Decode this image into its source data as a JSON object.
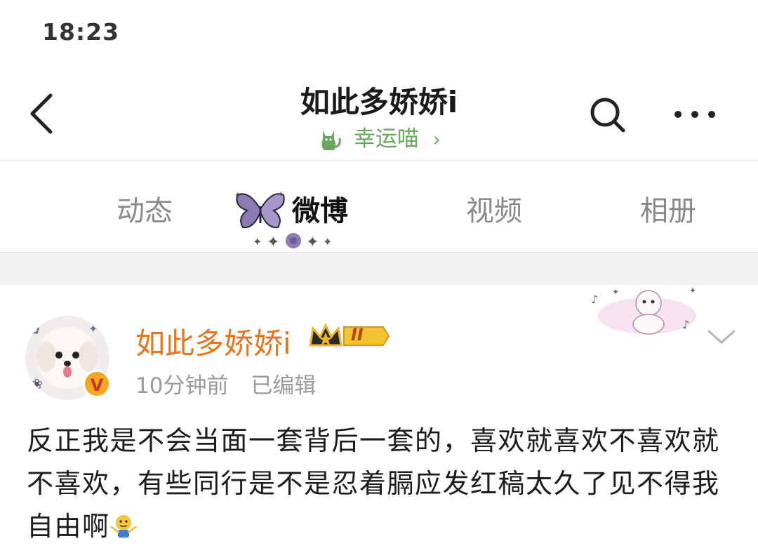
{
  "status_bar": {
    "time": "18:23"
  },
  "nav": {
    "title": "如此多娇娇i",
    "subtitle": "幸运喵",
    "subtitle_chevron": "›",
    "icons": {
      "back": "back-arrow-icon",
      "search": "search-icon",
      "more": "more-dots-icon"
    }
  },
  "tabs": [
    {
      "label": "动态",
      "active": false
    },
    {
      "label": "微博",
      "active": true
    },
    {
      "label": "视频",
      "active": false
    },
    {
      "label": "相册",
      "active": false
    }
  ],
  "post": {
    "author": "如此多娇娇i",
    "badge_level": "II",
    "verified_mark": "V",
    "time": "10分钟前",
    "edited": "已编辑",
    "text": "反正我是不会当面一套背后一套的，喜欢就喜欢不喜欢就不喜欢，有些同行是不是忍着膈应发红稿太久了见不得我自由啊",
    "emoji": "shrug-emoji-icon"
  },
  "colors": {
    "accent_name": "#e8741d",
    "subtitle_green": "#6aa75e",
    "tab_inactive": "#8a8a8a",
    "band": "#f2f2f2"
  }
}
